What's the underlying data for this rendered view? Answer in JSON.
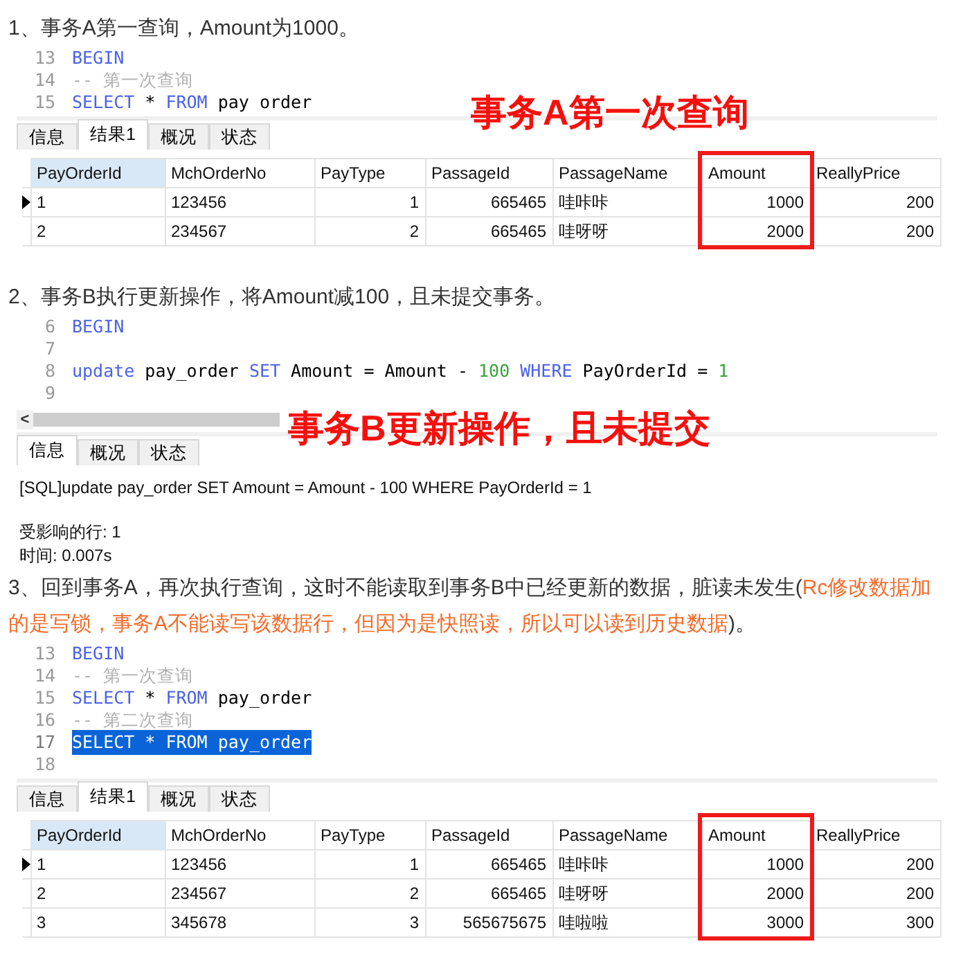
{
  "sections": [
    {
      "heading": [
        {
          "text": "1、事务A第一查询，Amount为1000。",
          "emphasis": false
        }
      ],
      "code": {
        "lines": [
          {
            "number": "13",
            "selected": false,
            "tokens": [
              {
                "kind": "keyword",
                "text": "BEGIN"
              }
            ]
          },
          {
            "number": "14",
            "selected": false,
            "tokens": [
              {
                "kind": "comment",
                "text": "-- 第一次查询"
              }
            ]
          },
          {
            "number": "15",
            "selected": false,
            "tokens": [
              {
                "kind": "keyword",
                "text": "SELECT"
              },
              {
                "kind": "plain",
                "text": " * "
              },
              {
                "kind": "keyword",
                "text": "FROM"
              },
              {
                "kind": "plain",
                "text": " pay order"
              }
            ]
          }
        ]
      },
      "annotation": "事务A第一次查询",
      "tabs": [
        {
          "label": "信息",
          "selected": false
        },
        {
          "label": "结果1",
          "selected": true
        },
        {
          "label": "概况",
          "selected": false
        },
        {
          "label": "状态",
          "selected": false
        }
      ],
      "table": {
        "columns": [
          {
            "label": "PayOrderId",
            "kind": "text",
            "selected": true,
            "highlighted": false
          },
          {
            "label": "MchOrderNo",
            "kind": "text",
            "selected": false,
            "highlighted": false
          },
          {
            "label": "PayType",
            "kind": "number",
            "selected": false,
            "highlighted": false
          },
          {
            "label": "PassageId",
            "kind": "number",
            "selected": false,
            "highlighted": false
          },
          {
            "label": "PassageName",
            "kind": "text",
            "selected": false,
            "highlighted": false
          },
          {
            "label": "Amount",
            "kind": "number",
            "selected": false,
            "highlighted": true
          },
          {
            "label": "ReallyPrice",
            "kind": "number",
            "selected": false,
            "highlighted": false
          }
        ],
        "rows": [
          {
            "current": true,
            "cells": [
              "1",
              "123456",
              "1",
              "665465",
              "哇咔咔",
              "1000",
              "200"
            ]
          },
          {
            "current": false,
            "cells": [
              "2",
              "234567",
              "2",
              "665465",
              "哇呀呀",
              "2000",
              "200"
            ]
          }
        ]
      }
    },
    {
      "heading": [
        {
          "text": "2、事务B执行更新操作，将Amount减100，且未提交事务。",
          "emphasis": false
        }
      ],
      "code": {
        "lines": [
          {
            "number": "6",
            "selected": false,
            "tokens": [
              {
                "kind": "keyword",
                "text": "BEGIN"
              }
            ]
          },
          {
            "number": "7",
            "selected": false
          },
          {
            "number": "8",
            "selected": false,
            "tokens": [
              {
                "kind": "keyword",
                "text": "update"
              },
              {
                "kind": "plain",
                "text": " pay_order "
              },
              {
                "kind": "keyword",
                "text": "SET"
              },
              {
                "kind": "plain",
                "text": " Amount = Amount - "
              },
              {
                "kind": "number",
                "text": "100"
              },
              {
                "kind": "keyword",
                "text": " WHERE"
              },
              {
                "kind": "plain",
                "text": " PayOrderId = "
              },
              {
                "kind": "number",
                "text": "1"
              }
            ]
          },
          {
            "number": "9",
            "selected": false
          }
        ],
        "scroll_button": "<"
      },
      "annotation": "事务B更新操作，且未提交",
      "tabs": [
        {
          "label": "信息",
          "selected": true
        },
        {
          "label": "概况",
          "selected": false
        },
        {
          "label": "状态",
          "selected": false
        }
      ],
      "message": {
        "sql": "[SQL]update pay_order SET Amount = Amount - 100 WHERE PayOrderId = 1",
        "details": [
          "受影响的行: 1",
          "时间: 0.007s"
        ]
      }
    },
    {
      "heading": [
        {
          "text": "3、回到事务A，再次执行查询，这时不能读取到事务B中已经更新的数据，脏读未发生(",
          "emphasis": false
        },
        {
          "text": "Rc修改数据加的是写锁，事务A不能读写该数据行，但因为是快照读，所以可以读到历史数据",
          "emphasis": true
        },
        {
          "text": ")。",
          "emphasis": false
        }
      ],
      "code": {
        "lines": [
          {
            "number": "13",
            "selected": false,
            "tokens": [
              {
                "kind": "keyword",
                "text": "BEGIN"
              }
            ]
          },
          {
            "number": "14",
            "selected": false,
            "tokens": [
              {
                "kind": "comment",
                "text": "-- 第一次查询"
              }
            ]
          },
          {
            "number": "15",
            "selected": false,
            "tokens": [
              {
                "kind": "keyword",
                "text": "SELECT"
              },
              {
                "kind": "plain",
                "text": " * "
              },
              {
                "kind": "keyword",
                "text": "FROM"
              },
              {
                "kind": "plain",
                "text": " pay_order"
              }
            ]
          },
          {
            "number": "16",
            "selected": false,
            "tokens": [
              {
                "kind": "comment",
                "text": "-- 第二次查询"
              }
            ]
          },
          {
            "number": "17",
            "selected": true,
            "tokens": [
              {
                "kind": "keyword",
                "text": "SELECT"
              },
              {
                "kind": "plain",
                "text": " * "
              },
              {
                "kind": "keyword",
                "text": "FROM"
              },
              {
                "kind": "plain",
                "text": " pay_order"
              }
            ]
          },
          {
            "number": "18",
            "selected": false
          }
        ]
      },
      "tabs": [
        {
          "label": "信息",
          "selected": false
        },
        {
          "label": "结果1",
          "selected": true
        },
        {
          "label": "概况",
          "selected": false
        },
        {
          "label": "状态",
          "selected": false
        }
      ],
      "table": {
        "columns": [
          {
            "label": "PayOrderId",
            "kind": "text",
            "selected": true,
            "highlighted": false
          },
          {
            "label": "MchOrderNo",
            "kind": "text",
            "selected": false,
            "highlighted": false
          },
          {
            "label": "PayType",
            "kind": "number",
            "selected": false,
            "highlighted": false
          },
          {
            "label": "PassageId",
            "kind": "number",
            "selected": false,
            "highlighted": false
          },
          {
            "label": "PassageName",
            "kind": "text",
            "selected": false,
            "highlighted": false
          },
          {
            "label": "Amount",
            "kind": "number",
            "selected": false,
            "highlighted": true
          },
          {
            "label": "ReallyPrice",
            "kind": "number",
            "selected": false,
            "highlighted": false
          }
        ],
        "rows": [
          {
            "current": true,
            "cells": [
              "1",
              "123456",
              "1",
              "665465",
              "哇咔咔",
              "1000",
              "200"
            ]
          },
          {
            "current": false,
            "cells": [
              "2",
              "234567",
              "2",
              "665465",
              "哇呀呀",
              "2000",
              "200"
            ]
          },
          {
            "current": false,
            "cells": [
              "3",
              "345678",
              "3",
              "565675675",
              "哇啦啦",
              "3000",
              "300"
            ]
          }
        ]
      }
    }
  ]
}
